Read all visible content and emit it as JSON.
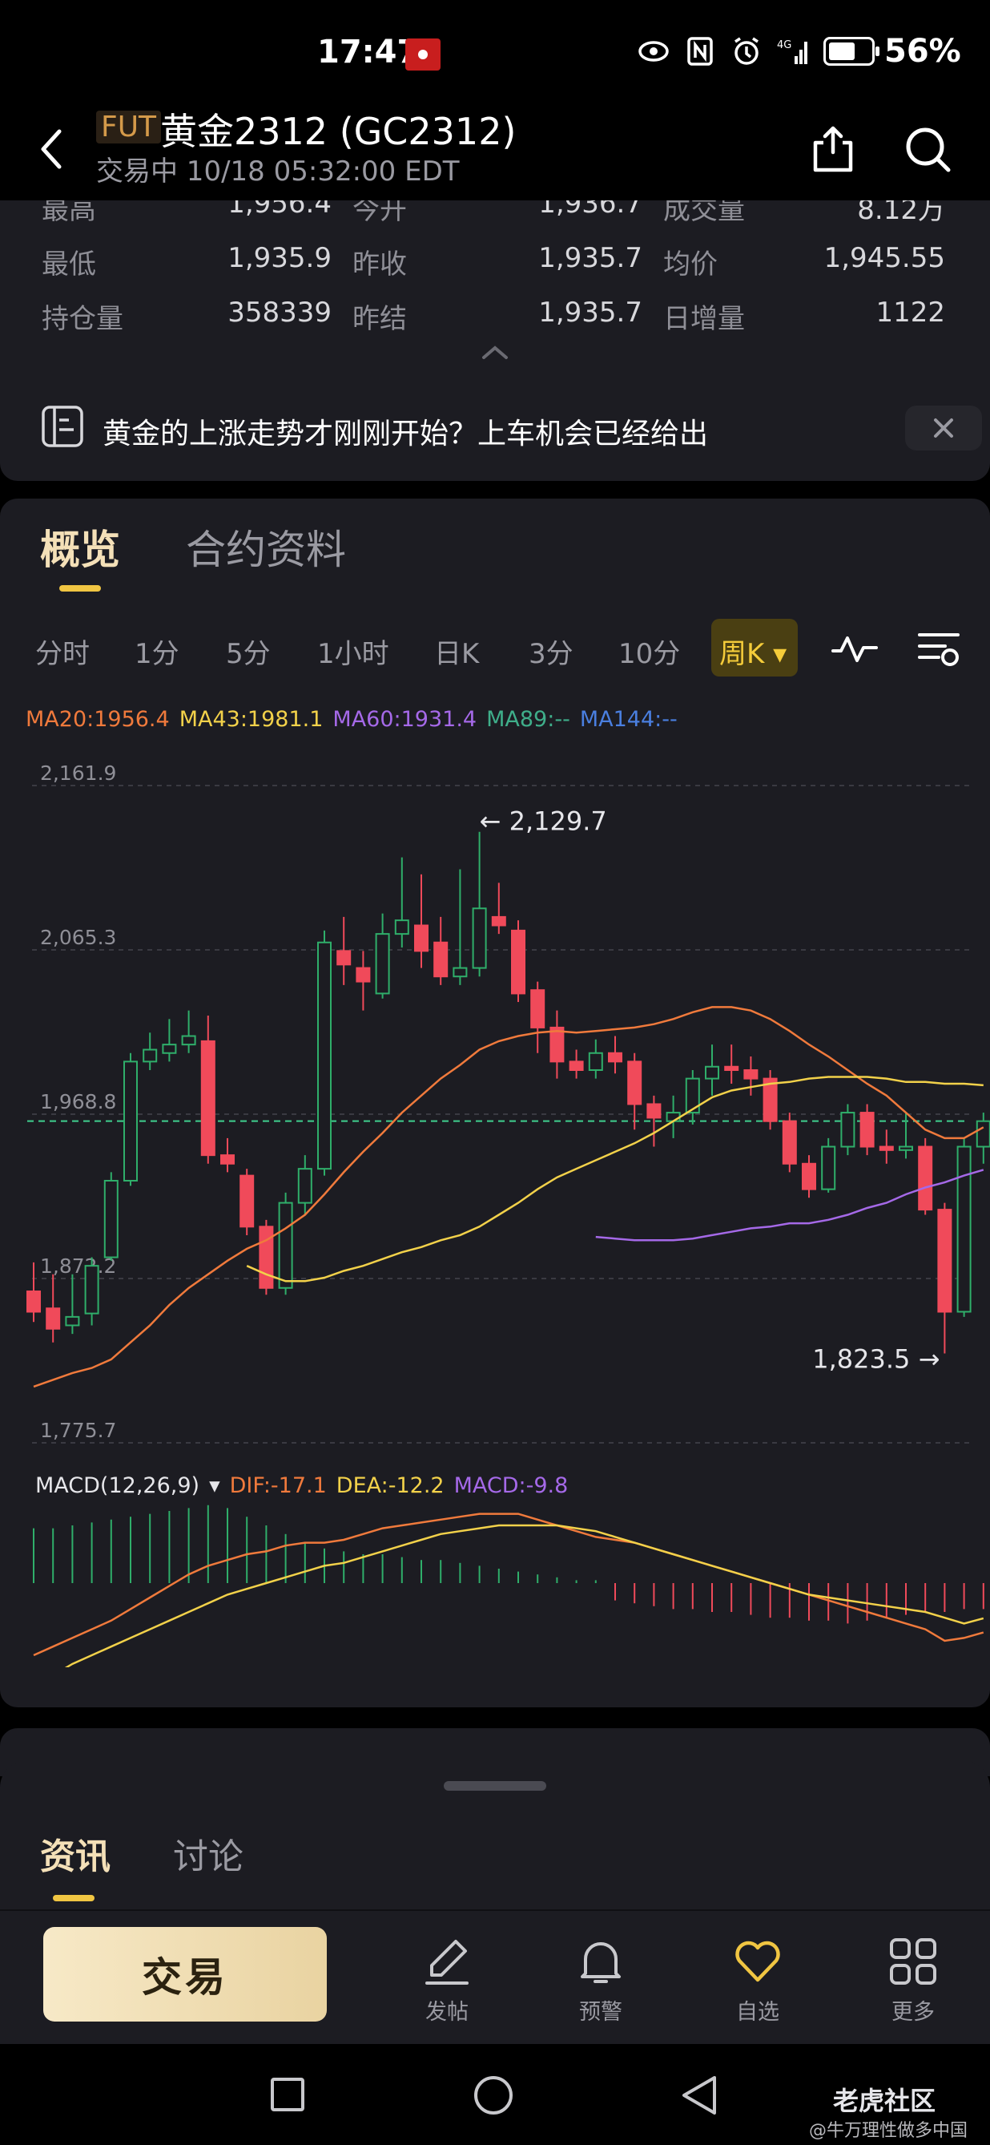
{
  "status_bar": {
    "time": "17:47",
    "battery": "56%"
  },
  "header": {
    "badge": "FUT",
    "title": "黄金2312 (GC2312)",
    "trade_status": "交易中 10/18 05:32:00 EDT"
  },
  "stats": {
    "rows": [
      [
        {
          "label": "最高",
          "value": "1,956.4"
        },
        {
          "label": "今开",
          "value": "1,936.7"
        },
        {
          "label": "成交量",
          "value": "8.12万"
        }
      ],
      [
        {
          "label": "最低",
          "value": "1,935.9"
        },
        {
          "label": "昨收",
          "value": "1,935.7"
        },
        {
          "label": "均价",
          "value": "1,945.55"
        }
      ],
      [
        {
          "label": "持仓量",
          "value": "358339"
        },
        {
          "label": "昨结",
          "value": "1,935.7"
        },
        {
          "label": "日增量",
          "value": "1122"
        }
      ]
    ]
  },
  "promo": {
    "text": "黄金的上涨走势才刚刚开始？上车机会已经给出"
  },
  "tabs": {
    "overview": "概览",
    "contract": "合约资料"
  },
  "periods": [
    "分时",
    "1分",
    "5分",
    "1小时",
    "日K",
    "3分",
    "10分"
  ],
  "active_period": "周K",
  "ma_legend": [
    {
      "text": "MA20:1956.4",
      "color": "#f07a3c"
    },
    {
      "text": "MA43:1981.1",
      "color": "#f2d14a"
    },
    {
      "text": "MA60:1931.4",
      "color": "#a569e8"
    },
    {
      "text": "MA89:--",
      "color": "#3fae8a"
    },
    {
      "text": "MA144:--",
      "color": "#4a7fe0"
    }
  ],
  "macd_legend": {
    "params": "MACD(12,26,9)",
    "dif": "DIF:-17.1",
    "dea": "DEA:-12.2",
    "macd": "MACD:-9.8"
  },
  "colors": {
    "up": "#2fae6a",
    "down": "#f04a5a",
    "ma20": "#f07a3c",
    "ma43": "#f2d14a",
    "ma60": "#a569e8",
    "accent": "#f0c542"
  },
  "chart_data": {
    "type": "candlestick",
    "title": "",
    "y_tick_labels": [
      "2,161.9",
      "2,065.3",
      "1,968.8",
      "1,872.2",
      "1,775.7"
    ],
    "ylim": [
      1775.7,
      2161.9
    ],
    "high_annotation": "← 2,129.7",
    "low_annotation": "1,823.5 →",
    "reference_line": 1960,
    "candles": [
      [
        1860,
        1848,
        1877,
        1842
      ],
      [
        1850,
        1838,
        1870,
        1830
      ],
      [
        1840,
        1845,
        1870,
        1835
      ],
      [
        1847,
        1875,
        1880,
        1840
      ],
      [
        1880,
        1925,
        1930,
        1878
      ],
      [
        1925,
        1995,
        2000,
        1922
      ],
      [
        1995,
        2002,
        2012,
        1990
      ],
      [
        2000,
        2005,
        2020,
        1995
      ],
      [
        2005,
        2010,
        2025,
        2000
      ],
      [
        2007,
        1940,
        2022,
        1935
      ],
      [
        1940,
        1935,
        1950,
        1930
      ],
      [
        1928,
        1898,
        1932,
        1893
      ],
      [
        1898,
        1862,
        1902,
        1858
      ],
      [
        1862,
        1912,
        1918,
        1858
      ],
      [
        1912,
        1932,
        1940,
        1905
      ],
      [
        1932,
        2065,
        2072,
        1928
      ],
      [
        2060,
        2052,
        2080,
        2040
      ],
      [
        2050,
        2042,
        2060,
        2025
      ],
      [
        2035,
        2070,
        2082,
        2032
      ],
      [
        2070,
        2078,
        2115,
        2062
      ],
      [
        2075,
        2060,
        2105,
        2050
      ],
      [
        2065,
        2045,
        2080,
        2040
      ],
      [
        2045,
        2050,
        2108,
        2040
      ],
      [
        2050,
        2085,
        2130,
        2045
      ],
      [
        2080,
        2075,
        2100,
        2070
      ],
      [
        2072,
        2035,
        2078,
        2030
      ],
      [
        2037,
        2015,
        2042,
        2000
      ],
      [
        2015,
        1995,
        2025,
        1985
      ],
      [
        1995,
        1990,
        2002,
        1985
      ],
      [
        1990,
        2000,
        2008,
        1985
      ],
      [
        2000,
        1995,
        2010,
        1988
      ],
      [
        1995,
        1970,
        2000,
        1955
      ],
      [
        1970,
        1962,
        1975,
        1945
      ],
      [
        1960,
        1965,
        1975,
        1950
      ],
      [
        1965,
        1985,
        1990,
        1958
      ],
      [
        1985,
        1992,
        2005,
        1975
      ],
      [
        1992,
        1990,
        2005,
        1982
      ],
      [
        1990,
        1985,
        1998,
        1975
      ],
      [
        1985,
        1960,
        1990,
        1955
      ],
      [
        1960,
        1935,
        1965,
        1930
      ],
      [
        1935,
        1920,
        1940,
        1915
      ],
      [
        1920,
        1945,
        1950,
        1918
      ],
      [
        1945,
        1965,
        1970,
        1940
      ],
      [
        1965,
        1945,
        1970,
        1940
      ],
      [
        1945,
        1943,
        1955,
        1935
      ],
      [
        1943,
        1945,
        1965,
        1938
      ],
      [
        1945,
        1908,
        1950,
        1905
      ],
      [
        1908,
        1848,
        1912,
        1823.5
      ],
      [
        1848,
        1945,
        1950,
        1845
      ],
      [
        1945,
        1960,
        1965,
        1935
      ]
    ],
    "ma20": [
      [
        0,
        1804
      ],
      [
        1,
        1808
      ],
      [
        2,
        1812
      ],
      [
        3,
        1815
      ],
      [
        4,
        1820
      ],
      [
        5,
        1830
      ],
      [
        6,
        1840
      ],
      [
        7,
        1852
      ],
      [
        8,
        1862
      ],
      [
        9,
        1870
      ],
      [
        10,
        1878
      ],
      [
        11,
        1885
      ],
      [
        12,
        1890
      ],
      [
        13,
        1897
      ],
      [
        14,
        1905
      ],
      [
        15,
        1917
      ],
      [
        16,
        1930
      ],
      [
        17,
        1942
      ],
      [
        18,
        1953
      ],
      [
        19,
        1965
      ],
      [
        20,
        1975
      ],
      [
        21,
        1985
      ],
      [
        22,
        1993
      ],
      [
        23,
        2002
      ],
      [
        24,
        2007
      ],
      [
        25,
        2010
      ],
      [
        26,
        2012
      ],
      [
        27,
        2013
      ],
      [
        28,
        2012
      ],
      [
        29,
        2013
      ],
      [
        30,
        2014
      ],
      [
        31,
        2015
      ],
      [
        32,
        2017
      ],
      [
        33,
        2020
      ],
      [
        34,
        2024
      ],
      [
        35,
        2027
      ],
      [
        36,
        2027
      ],
      [
        37,
        2025
      ],
      [
        38,
        2020
      ],
      [
        39,
        2013
      ],
      [
        40,
        2005
      ],
      [
        41,
        1998
      ],
      [
        42,
        1990
      ],
      [
        43,
        1982
      ],
      [
        44,
        1975
      ],
      [
        45,
        1965
      ],
      [
        46,
        1955
      ],
      [
        47,
        1950
      ],
      [
        48,
        1950
      ],
      [
        49,
        1956.4
      ]
    ],
    "ma43": [
      [
        11,
        1875
      ],
      [
        12,
        1870
      ],
      [
        13,
        1866
      ],
      [
        14,
        1866
      ],
      [
        15,
        1868
      ],
      [
        16,
        1872
      ],
      [
        17,
        1875
      ],
      [
        18,
        1879
      ],
      [
        19,
        1883
      ],
      [
        20,
        1886
      ],
      [
        21,
        1890
      ],
      [
        22,
        1893
      ],
      [
        23,
        1898
      ],
      [
        24,
        1905
      ],
      [
        25,
        1912
      ],
      [
        26,
        1920
      ],
      [
        27,
        1927
      ],
      [
        28,
        1932
      ],
      [
        29,
        1937
      ],
      [
        30,
        1942
      ],
      [
        31,
        1947
      ],
      [
        32,
        1953
      ],
      [
        33,
        1960
      ],
      [
        34,
        1967
      ],
      [
        35,
        1974
      ],
      [
        36,
        1978
      ],
      [
        37,
        1980
      ],
      [
        38,
        1982
      ],
      [
        39,
        1983
      ],
      [
        40,
        1985
      ],
      [
        41,
        1986
      ],
      [
        42,
        1986
      ],
      [
        43,
        1986
      ],
      [
        44,
        1985
      ],
      [
        45,
        1983
      ],
      [
        46,
        1983
      ],
      [
        47,
        1982
      ],
      [
        48,
        1982
      ],
      [
        49,
        1981.1
      ]
    ],
    "ma60": [
      [
        29,
        1892
      ],
      [
        30,
        1891
      ],
      [
        31,
        1890
      ],
      [
        32,
        1890
      ],
      [
        33,
        1890
      ],
      [
        34,
        1891
      ],
      [
        35,
        1893
      ],
      [
        36,
        1895
      ],
      [
        37,
        1897
      ],
      [
        38,
        1898
      ],
      [
        39,
        1900
      ],
      [
        40,
        1900
      ],
      [
        41,
        1902
      ],
      [
        42,
        1905
      ],
      [
        43,
        1909
      ],
      [
        44,
        1912
      ],
      [
        45,
        1917
      ],
      [
        46,
        1921
      ],
      [
        47,
        1924
      ],
      [
        48,
        1928
      ],
      [
        49,
        1931.4
      ]
    ],
    "macd_hist": [
      19,
      19,
      20,
      21,
      22,
      23,
      24,
      25,
      26,
      27,
      26,
      23,
      20,
      17,
      14,
      12,
      11,
      10,
      10,
      9,
      8,
      8,
      7,
      6,
      5,
      4,
      3,
      2,
      1,
      1,
      -6,
      -7,
      -8,
      -9,
      -9,
      -10,
      -10,
      -11,
      -12,
      -12,
      -13,
      -13,
      -14,
      -13,
      -12,
      -11,
      -10,
      -10,
      -9,
      -9
    ],
    "dif": [
      -25,
      -22,
      -19,
      -16,
      -13,
      -9,
      -5,
      -1,
      3,
      6,
      8,
      10,
      11,
      13,
      14,
      14,
      15,
      17,
      19,
      20,
      21,
      22,
      23,
      24,
      24,
      24,
      22,
      20,
      18,
      16,
      15,
      14,
      12,
      10,
      8,
      6,
      4,
      2,
      0,
      -2,
      -4,
      -6,
      -8,
      -10,
      -12,
      -14,
      -16,
      -20,
      -19,
      -17.1
    ],
    "dea": [
      -35,
      -32,
      -28,
      -25,
      -22,
      -19,
      -16,
      -13,
      -10,
      -7,
      -4,
      -2,
      0,
      2,
      4,
      6,
      7,
      9,
      11,
      13,
      15,
      17,
      18,
      19,
      20,
      20,
      20,
      20,
      19,
      18,
      16,
      14,
      12,
      10,
      8,
      6,
      4,
      2,
      0,
      -2,
      -4,
      -5,
      -6,
      -7,
      -8,
      -9,
      -10,
      -12,
      -14,
      -12.2
    ]
  },
  "bottom_sheet": {
    "tab_news": "资讯",
    "tab_discuss": "讨论"
  },
  "bottom_nav": {
    "trade": "交易",
    "post": "发帖",
    "alert": "预警",
    "watchlist": "自选",
    "more": "更多"
  },
  "watermark": {
    "logo": "老虎社区",
    "sub": "@牛万理性做多中国"
  }
}
